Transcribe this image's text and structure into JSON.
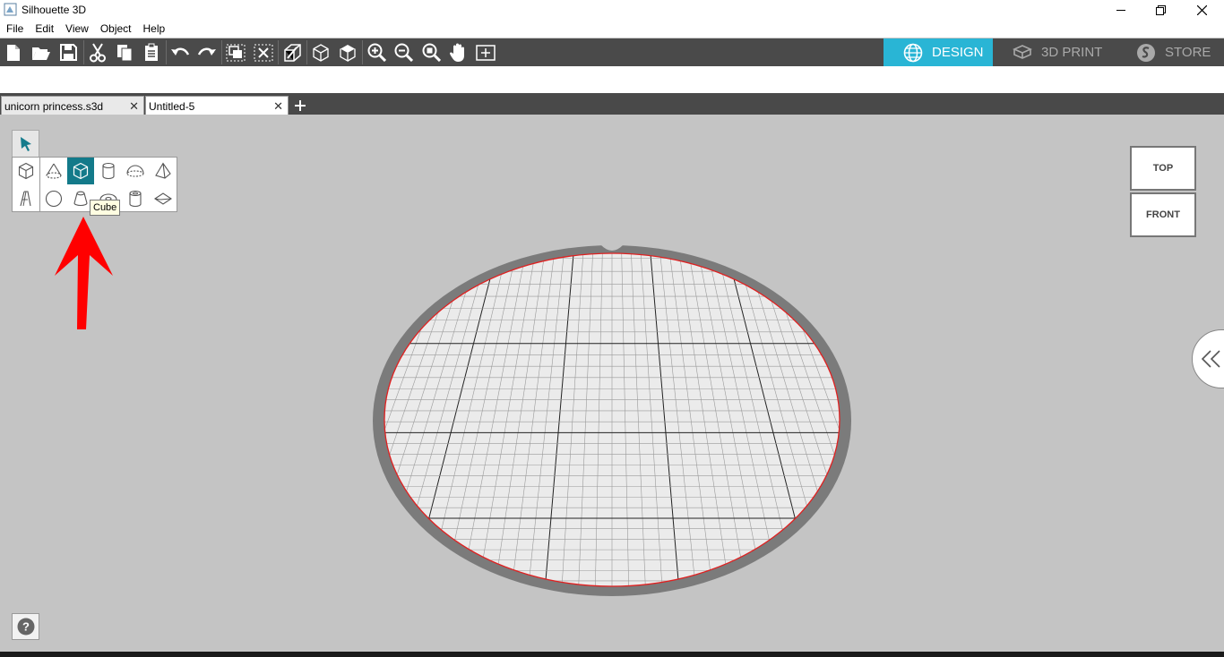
{
  "window": {
    "title": "Silhouette 3D",
    "icon": "silhouette-app-icon",
    "controls": [
      "minimize-icon",
      "restore-icon",
      "close-icon"
    ]
  },
  "menu": {
    "items": [
      "File",
      "Edit",
      "View",
      "Object",
      "Help"
    ]
  },
  "toolbar": {
    "buttons": [
      "new-file-icon",
      "open-folder-icon",
      "save-icon",
      "cut-icon",
      "copy-icon",
      "paste-icon",
      "undo-icon",
      "redo-icon",
      "group-icon",
      "ungroup-icon",
      "extrude-icon",
      "box-outline-icon",
      "box-solid-icon",
      "zoom-in-icon",
      "zoom-out-icon",
      "zoom-fit-icon",
      "pan-hand-icon",
      "fit-page-icon"
    ],
    "modes": [
      {
        "label": "DESIGN",
        "icon": "globe-icon",
        "active": true
      },
      {
        "label": "3D PRINT",
        "icon": "printer-3d-icon",
        "active": false
      },
      {
        "label": "STORE",
        "icon": "store-s-icon",
        "active": false
      }
    ],
    "active_color": "#29b5d5"
  },
  "tabs": [
    {
      "label": "unicorn princess.s3d",
      "active": false
    },
    {
      "label": "Untitled-5",
      "active": true
    }
  ],
  "shapes_panel": {
    "select_tool_icon": "select-arrow-icon",
    "row1": [
      "cube-outline-icon",
      "cone-icon",
      "cube-icon",
      "cylinder-icon",
      "hemisphere-icon",
      "pyramid-icon"
    ],
    "row2": [
      "text-icon",
      "sphere-icon",
      "truncated-cone-icon",
      "torus-icon",
      "tube-icon",
      "diamond-icon"
    ],
    "selected": "cube-icon",
    "tooltip": "Cube",
    "accent": "#137a8a"
  },
  "view_cube": {
    "top_label": "TOP",
    "front_label": "FRONT"
  },
  "help_label": "?",
  "annotation": {
    "icon": "red-up-arrow-icon",
    "color": "#ff0000"
  }
}
